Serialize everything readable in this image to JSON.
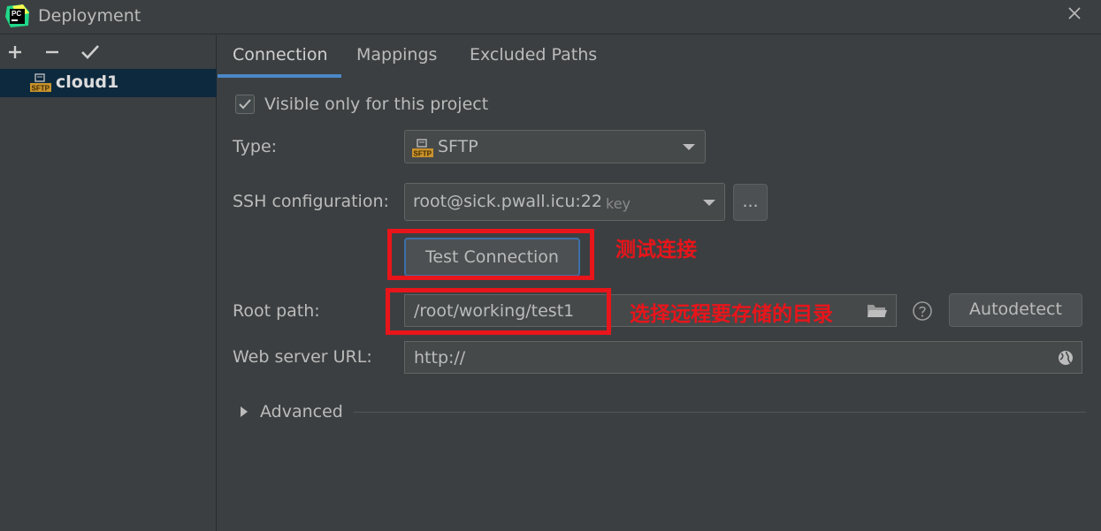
{
  "window": {
    "title": "Deployment"
  },
  "sidebar": {
    "toolbar": {
      "add": "+",
      "remove": "−",
      "apply": "✔"
    },
    "servers": [
      {
        "label": "cloud1",
        "icon": "sftp-server-icon"
      }
    ]
  },
  "tabs": [
    {
      "label": "Connection",
      "active": true
    },
    {
      "label": "Mappings",
      "active": false
    },
    {
      "label": "Excluded Paths",
      "active": false
    }
  ],
  "connection": {
    "visible_only_label": "Visible only for this project",
    "visible_only_checked": true,
    "type_label": "Type:",
    "type_value": "SFTP",
    "ssh_label": "SSH configuration:",
    "ssh_value": "root@sick.pwall.icu:22",
    "ssh_hint": "key",
    "ssh_more_button": "...",
    "test_connection_button": "Test Connection",
    "root_path_label": "Root path:",
    "root_path_value": "/root/working/test1",
    "autodetect_button": "Autodetect",
    "web_url_label": "Web server URL:",
    "web_url_value": "http://",
    "advanced_label": "Advanced"
  },
  "annotations": {
    "test_connection_note": "测试连接",
    "root_path_note": "选择远程要存储的目录"
  },
  "colors": {
    "background": "#3c3f41",
    "selection": "#0d293e",
    "tab_accent": "#4a88c7",
    "annotation_red": "#e8151b"
  }
}
